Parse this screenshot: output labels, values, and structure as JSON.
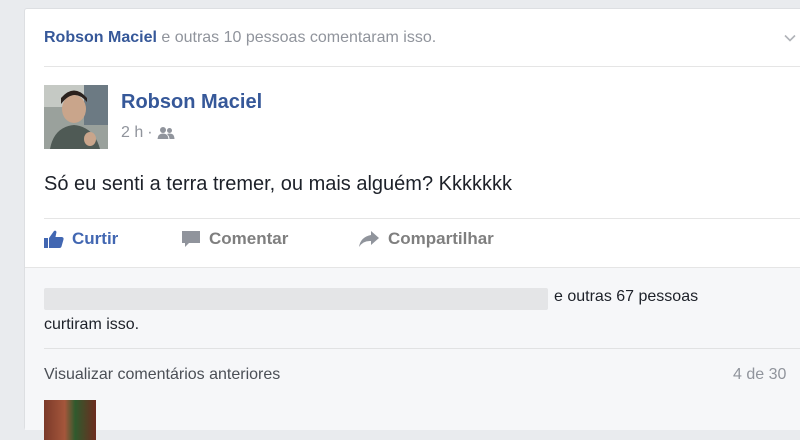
{
  "notice": {
    "actor": "Robson Maciel",
    "rest": " e outras 10 pessoas comentaram isso."
  },
  "post": {
    "author": "Robson Maciel",
    "time": "2 h",
    "dot": "·",
    "audience_icon": "friends-icon",
    "text": "Só eu senti a terra tremer, ou mais alguém? Kkkkkkk"
  },
  "actions": {
    "like": "Curtir",
    "comment": "Comentar",
    "share": "Compartilhar"
  },
  "likes": {
    "tail": "e outras 67 pessoas",
    "line2": "curtiram isso."
  },
  "comments": {
    "view_previous": "Visualizar comentários anteriores",
    "count": "4 de 30"
  },
  "colors": {
    "link": "#365899",
    "like_blue": "#4267b2",
    "muted": "#90949c",
    "background": "#e9ebee"
  }
}
